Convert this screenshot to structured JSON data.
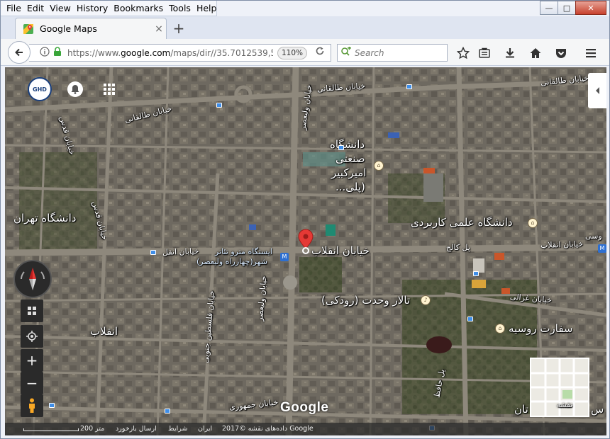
{
  "menu": [
    "File",
    "Edit",
    "View",
    "History",
    "Bookmarks",
    "Tools",
    "Help"
  ],
  "window_controls": {
    "minimize": "—",
    "maximize": "□",
    "close": "✕"
  },
  "tab": {
    "title": "Google Maps",
    "close": "×",
    "favicon": "google-maps-pin-icon"
  },
  "new_tab": "+",
  "url": {
    "prefix": "https://www.",
    "domain": "google.com",
    "path": "/maps/dir//35.7012539,51"
  },
  "zoom_level": "110%",
  "search": {
    "placeholder": "Search"
  },
  "map": {
    "labels": {
      "taleghani_1": "خیابان طالقانی",
      "taleghani_2": "خیابان طالقانی",
      "taleghani_3": "خیابان طالقانی",
      "qods": "خیابان قدس",
      "amirkabir_1": "دانشگاه",
      "amirkabir_2": "صنعتی",
      "amirkabir_3": "امیرکبیر",
      "amirkabir_4": "(پلی...",
      "tehran_univ": "دانشگاه تهران",
      "elmi_karbordi": "دانشگاه علمی کاربردی",
      "enghelab_st": "خیابان انقلاب",
      "enghelab_st_2": "خیابان انقل",
      "enghelab_st_3": "خیابان انقلاب",
      "metro_1": "ایستگاه مترو تئاتر",
      "metro_2": "شهر(چهارراه ولیعصر)",
      "pol_kalej": "پل کالج",
      "tousi": "وسی",
      "vahdat": "تالار وحدت (رودکی)",
      "ghazali": "خیابان غزالی",
      "russia": "سفارت روسیه",
      "enghelab": "انقلاب",
      "felestin": "خیابان فلسطین جنوبی",
      "valiasr": "خیابان ولیعصر",
      "valiasr_n": "خیابان ولیعصر",
      "hafez": "پل حافظ",
      "jomhouri": "خیابان جمهوری",
      "bottom_right": "تان",
      "side_s": "س"
    },
    "logo_text": "GHD",
    "google_logo": "Google",
    "minimap_label": "نقشه",
    "footer": {
      "data": "داده‌های نقشه ©2017 Google",
      "iran": "ایران",
      "terms": "شرایط",
      "feedback": "ارسال بازخورد",
      "scale": "200 متر"
    }
  },
  "colors": {
    "pin": "#e53935",
    "accent_blue": "#2d6fd1",
    "map_base": "#6d6a62"
  }
}
